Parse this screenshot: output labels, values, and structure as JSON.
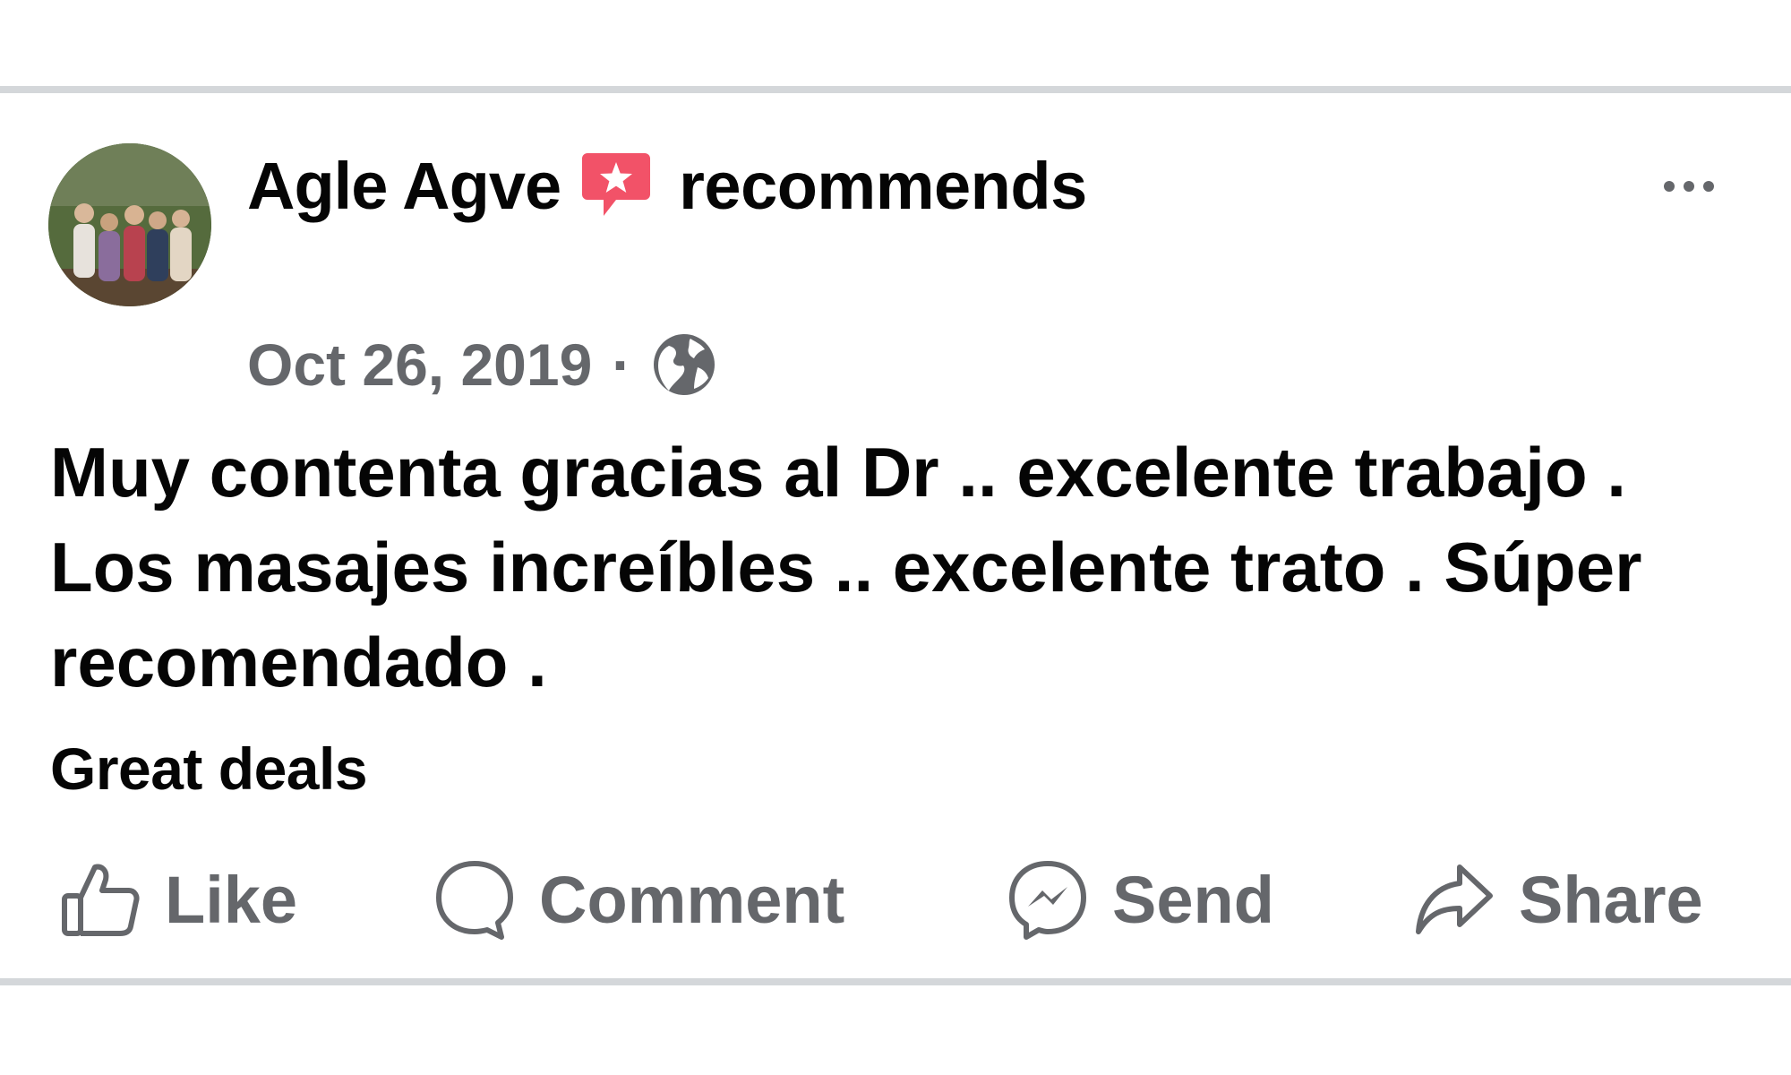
{
  "post": {
    "author": "Agle Agve",
    "recommendation_text": "recommends",
    "date": "Oct 26, 2019",
    "separator": "·",
    "privacy_icon": "globe-icon",
    "more_icon": "more-horizontal-icon",
    "body": "Muy contenta gracias al Dr .. excelente trabajo . Los masajes increíbles .. excelente trato . Súper recomendado .",
    "tag": "Great deals"
  },
  "actions": {
    "like": {
      "label": "Like",
      "icon": "thumbs-up-icon"
    },
    "comment": {
      "label": "Comment",
      "icon": "comment-bubble-icon"
    },
    "send": {
      "label": "Send",
      "icon": "messenger-icon"
    },
    "share": {
      "label": "Share",
      "icon": "share-arrow-icon"
    }
  },
  "colors": {
    "text_primary": "#050505",
    "text_secondary": "#65676b",
    "recommend_badge": "#f25268",
    "divider": "#d4d7da"
  }
}
